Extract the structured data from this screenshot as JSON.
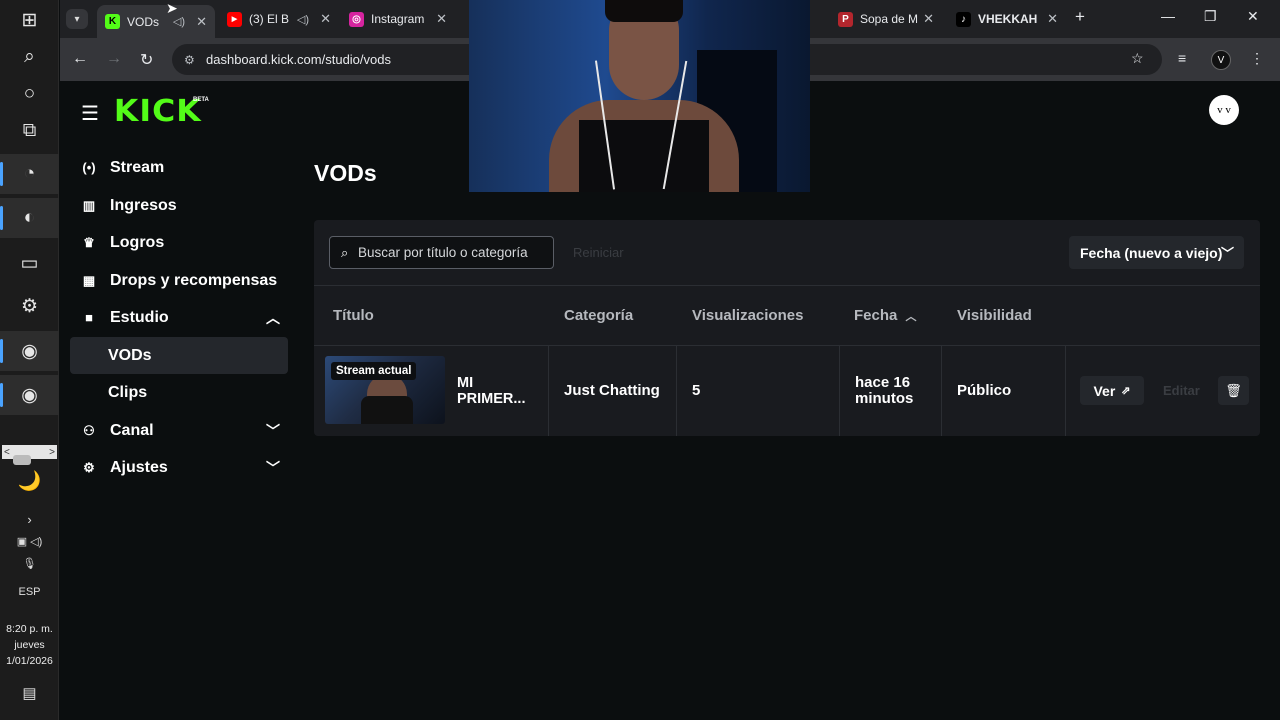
{
  "taskbar": {
    "lang": "ESP",
    "time": "8:20 p. m.",
    "day": "jueves",
    "date": "1/01/2026"
  },
  "browser": {
    "tabs": [
      {
        "label": "VODs",
        "favicon_color": "#53fc18",
        "favicon_text": "K",
        "active": true
      },
      {
        "label": "(3) El B",
        "favicon_color": "#ff0000",
        "favicon_text": "▶",
        "active": false
      },
      {
        "label": "Instagram",
        "favicon_color": "#d6249f",
        "favicon_text": "◎",
        "active": false
      },
      {
        "label": "Sopa de M",
        "favicon_color": "#b3262d",
        "favicon_text": "P",
        "active": false
      },
      {
        "label": "VHEKKAH",
        "favicon_color": "#000000",
        "favicon_text": "♪",
        "active": false
      }
    ],
    "url": "dashboard.kick.com/studio/vods",
    "profile_initial": "V"
  },
  "header": {
    "logo": "KICK",
    "logo_badge": "BETA",
    "avatar_initials": "v v"
  },
  "sidebar": {
    "items": [
      {
        "label": "Stream",
        "icon": "broadcast-icon"
      },
      {
        "label": "Ingresos",
        "icon": "bar-chart-icon"
      },
      {
        "label": "Logros",
        "icon": "trophy-icon"
      },
      {
        "label": "Drops y recompensas",
        "icon": "gift-icon"
      },
      {
        "label": "Estudio",
        "icon": "video-camera-icon"
      },
      {
        "label": "VODs"
      },
      {
        "label": "Clips"
      },
      {
        "label": "Canal",
        "icon": "users-icon"
      },
      {
        "label": "Ajustes",
        "icon": "gear-icon"
      }
    ]
  },
  "main": {
    "title": "VODs",
    "search_placeholder": "Buscar por título o categoría",
    "reset_label": "Reiniciar",
    "sort_label": "Fecha (nuevo a viejo)",
    "columns": [
      "Título",
      "Categoría",
      "Visualizaciones",
      "Fecha",
      "Visibilidad"
    ],
    "rows": [
      {
        "badge": "Stream actual",
        "title": "MI PRIMER...",
        "category": "Just Chatting",
        "views": "5",
        "date": "hace 16 minutos",
        "visibility": "Público"
      }
    ],
    "view_label": "Ver",
    "edit_label": "Editar"
  },
  "colors": {
    "accent": "#53fc18",
    "background": "#0b0e0f",
    "panel": "#191b1f"
  }
}
